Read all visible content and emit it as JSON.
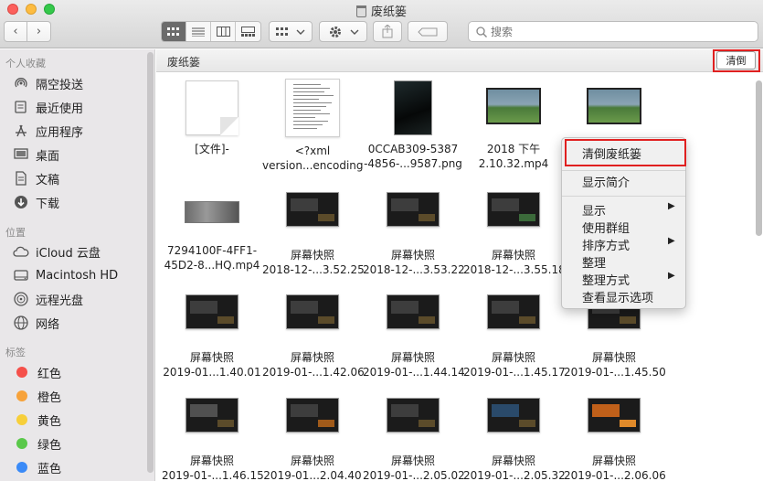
{
  "window": {
    "title": "废纸篓"
  },
  "toolbar": {
    "back_glyph": "‹",
    "forward_glyph": "›",
    "search_placeholder": "搜索"
  },
  "sidebar": {
    "sections": {
      "favorites": "个人收藏",
      "locations": "位置",
      "tags": "标签"
    },
    "favorites": [
      {
        "label": "隔空投送",
        "icon": "airdrop-icon"
      },
      {
        "label": "最近使用",
        "icon": "recents-icon"
      },
      {
        "label": "应用程序",
        "icon": "applications-icon"
      },
      {
        "label": "桌面",
        "icon": "desktop-icon"
      },
      {
        "label": "文稿",
        "icon": "documents-icon"
      },
      {
        "label": "下载",
        "icon": "downloads-icon"
      }
    ],
    "locations": [
      {
        "label": "iCloud 云盘",
        "icon": "icloud-icon"
      },
      {
        "label": "Macintosh HD",
        "icon": "hard-drive-icon"
      },
      {
        "label": "远程光盘",
        "icon": "remote-disc-icon"
      },
      {
        "label": "网络",
        "icon": "network-icon"
      }
    ],
    "tags": [
      {
        "label": "红色",
        "color": "#f5504a"
      },
      {
        "label": "橙色",
        "color": "#f7a23a"
      },
      {
        "label": "黄色",
        "color": "#f7cf3a"
      },
      {
        "label": "绿色",
        "color": "#5ac84a"
      },
      {
        "label": "蓝色",
        "color": "#3a8af7"
      }
    ]
  },
  "pathbar": {
    "title": "废纸篓",
    "empty_button": "清倒"
  },
  "files": [
    {
      "line1": "[文件]-",
      "line2": "",
      "kind": "doc"
    },
    {
      "line1": "<?xml",
      "line2": "version...encoding",
      "kind": "xml"
    },
    {
      "line1": "0CCAB309-5387",
      "line2": "-4856-...9587.png",
      "kind": "png"
    },
    {
      "line1": "2018 下午",
      "line2": "2.10.32.mp4",
      "kind": "video"
    },
    {
      "line1": "",
      "line2": "",
      "kind": "video"
    },
    {
      "line1": "7294100F-4FF1-",
      "line2": "45D2-8...HQ.mp4",
      "kind": "wide"
    },
    {
      "line1": "屏幕快照",
      "line2": "2018-12-...3.52.25",
      "kind": "screen"
    },
    {
      "line1": "屏幕快照",
      "line2": "2018-12-...3.53.22",
      "kind": "screen"
    },
    {
      "line1": "屏幕快照",
      "line2": "2018-12-...3.55.18",
      "kind": "screen"
    },
    {
      "line1": "屏幕快照",
      "line2": "2019-01...1.40.01",
      "kind": "screen"
    },
    {
      "line1": "屏幕快照",
      "line2": "2019-01-...1.42.06",
      "kind": "screen"
    },
    {
      "line1": "屏幕快照",
      "line2": "2019-01-...1.44.14",
      "kind": "screen"
    },
    {
      "line1": "屏幕快照",
      "line2": "2019-01-...1.45.17",
      "kind": "screen"
    },
    {
      "line1": "屏幕快照",
      "line2": "2019-01-...1.45.50",
      "kind": "screen"
    },
    {
      "line1": "屏幕快照",
      "line2": "2019-01-...1.46.15",
      "kind": "screen"
    },
    {
      "line1": "屏幕快照",
      "line2": "2019-01...2.04.40",
      "kind": "screen"
    },
    {
      "line1": "屏幕快照",
      "line2": "2019-01-...2.05.02",
      "kind": "screen"
    },
    {
      "line1": "屏幕快照",
      "line2": "2019-01-...2.05.32",
      "kind": "screen"
    },
    {
      "line1": "屏幕快照",
      "line2": "2019-01-...2.06.06",
      "kind": "screen"
    }
  ],
  "context_menu": {
    "empty_trash": "清倒废纸篓",
    "get_info": "显示简介",
    "view": "显示",
    "use_groups": "使用群组",
    "sort_by": "排序方式",
    "clean_up": "整理",
    "clean_up_by": "整理方式",
    "show_view_options": "查看显示选项",
    "submenu_arrow": "▶"
  }
}
